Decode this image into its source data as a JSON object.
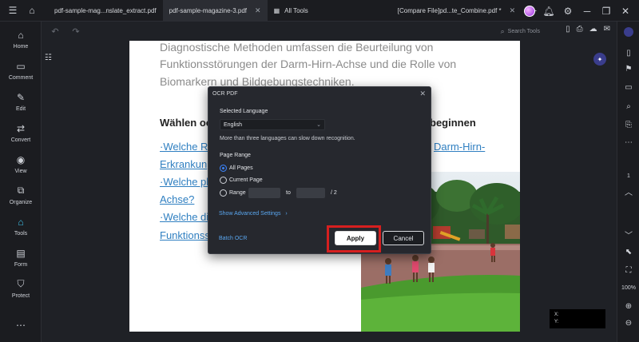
{
  "titlebar": {
    "tabs": [
      {
        "label": "pdf-sample-mag...nslate_extract.pdf",
        "active": false
      },
      {
        "label": "pdf-sample-magazine-3.pdf",
        "active": true
      },
      {
        "label": "All Tools",
        "active": false
      },
      {
        "label": "[Compare  File]pd...te_Combine.pdf *",
        "active": false
      }
    ]
  },
  "sidebar": {
    "items": [
      {
        "label": "Home",
        "icon": "home-icon"
      },
      {
        "label": "Comment",
        "icon": "comment-icon"
      },
      {
        "label": "Edit",
        "icon": "edit-icon"
      },
      {
        "label": "Convert",
        "icon": "convert-icon"
      },
      {
        "label": "View",
        "icon": "view-icon"
      },
      {
        "label": "Organize",
        "icon": "organize-icon"
      },
      {
        "label": "Tools",
        "icon": "tools-icon"
      },
      {
        "label": "Form",
        "icon": "form-icon"
      },
      {
        "label": "Protect",
        "icon": "protect-icon"
      }
    ]
  },
  "toolbar": {
    "search_placeholder": "Search Tools"
  },
  "right_sidebar": {
    "page_number": "1",
    "zoom": "100%"
  },
  "document": {
    "lines_gray": [
      "Diagnostische Methoden umfassen die Beurteilung von",
      "Funktionsstörungen der Darm-Hirn-Achse und die Rolle von",
      "Biomarkern und Bildgebungstechniken."
    ],
    "heading_left": "Wählen oc",
    "heading_right": "beginnen",
    "links_left": [
      "·Welche Ro",
      "Erkrankun",
      "·Welche ph",
      "Achse?",
      "·Welche di",
      "Funktionss"
    ],
    "link_right": "Darm-Hirn-"
  },
  "dialog": {
    "title": "OCR PDF",
    "selected_language_label": "Selected Language",
    "language_value": "English",
    "hint": "More than three languages can slow down recognition.",
    "page_range_label": "Page Range",
    "options": [
      "All Pages",
      "Current Page",
      "Range"
    ],
    "range_to": "to",
    "range_total": "/ 2",
    "advanced_link": "Show Advanced Settings",
    "batch_link": "Batch OCR",
    "apply": "Apply",
    "cancel": "Cancel"
  },
  "coords": {
    "x_label": "X:",
    "y_label": "Y:"
  }
}
